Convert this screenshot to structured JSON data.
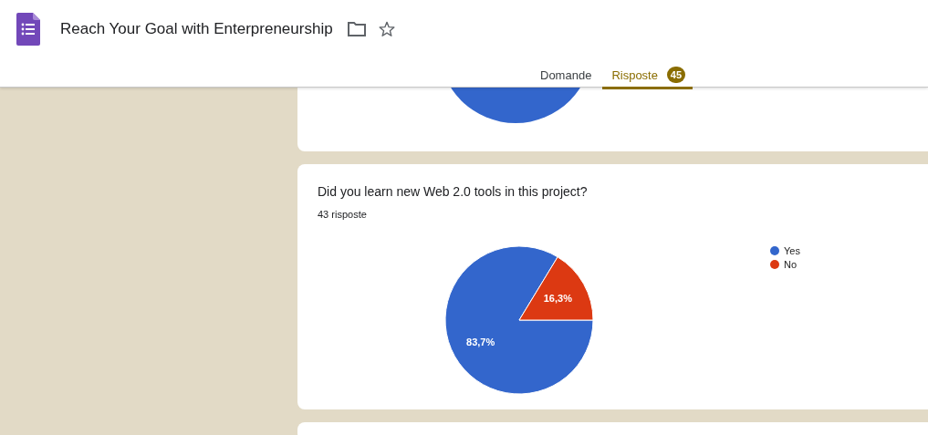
{
  "header": {
    "title": "Reach Your Goal with Enterpreneurship"
  },
  "tabs": [
    {
      "label": "Domande",
      "selected": false
    },
    {
      "label": "Risposte",
      "selected": true,
      "badge": "45"
    }
  ],
  "cards": [
    {
      "kind": "partial"
    },
    {
      "kind": "question",
      "question": "Did you learn new Web 2.0 tools in this project?",
      "responses": "43 risposte",
      "legend": [
        {
          "color": "#3366cc"
        },
        {
          "color": "#dc3912"
        }
      ],
      "chart_data": {
        "type": "pie",
        "categories": [
          "Yes",
          "No"
        ],
        "values": [
          83.7,
          16.3
        ],
        "value_labels": [
          "83,7%",
          "16,3%"
        ]
      }
    }
  ]
}
